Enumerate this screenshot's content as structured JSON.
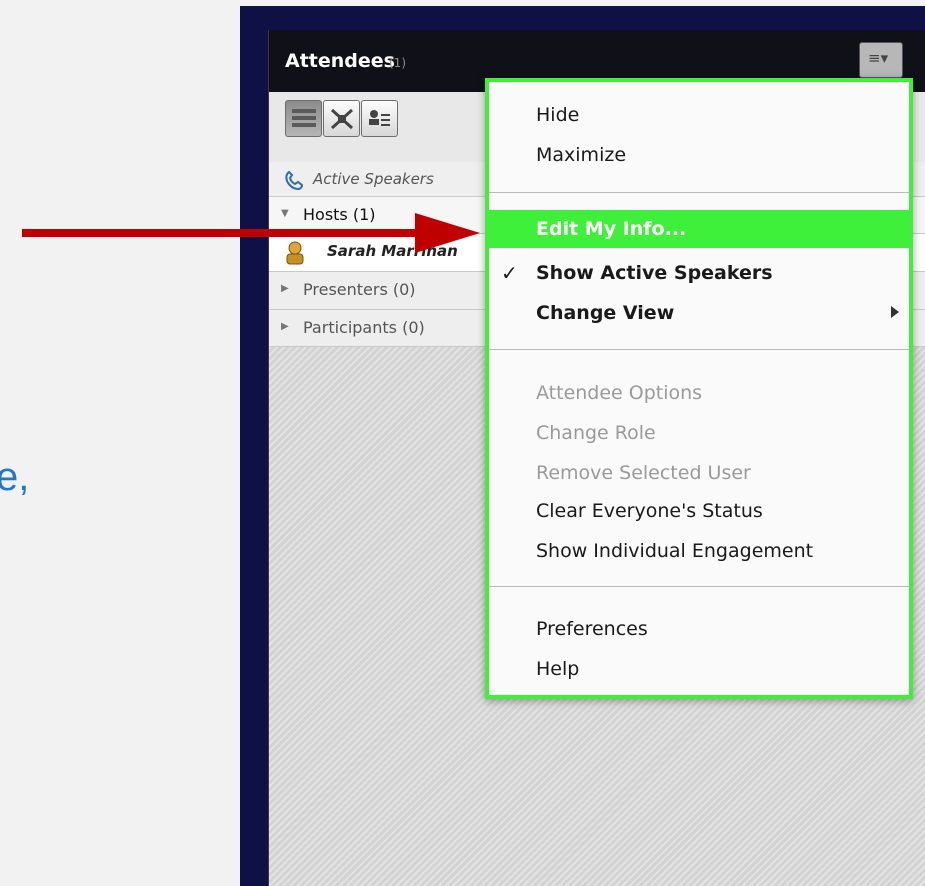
{
  "slide": {
    "partial_text": "e,"
  },
  "panel": {
    "title": "Attendees",
    "count": "(1)",
    "active_speakers_label": "Active Speakers",
    "sections": [
      {
        "label": "Hosts (1)",
        "expanded": true
      },
      {
        "label": "Presenters (0)",
        "expanded": false
      },
      {
        "label": "Participants (0)",
        "expanded": false
      }
    ],
    "host_user": "Sarah Marrinan"
  },
  "menu": {
    "group1": [
      "Hide",
      "Maximize"
    ],
    "group2": {
      "edit_info": "Edit My Info...",
      "show_active_speakers": "Show Active Speakers",
      "change_view": "Change View"
    },
    "group3": {
      "attendee_options": "Attendee Options",
      "change_role": "Change Role",
      "remove_user": "Remove Selected User",
      "clear_status": "Clear Everyone's Status",
      "show_engagement": "Show Individual Engagement"
    },
    "group4": [
      "Preferences",
      "Help"
    ]
  },
  "colors": {
    "highlight": "#3ef03a",
    "frame": "#0f1046",
    "arrow": "#c00000",
    "slide_text": "#1f78c8"
  }
}
